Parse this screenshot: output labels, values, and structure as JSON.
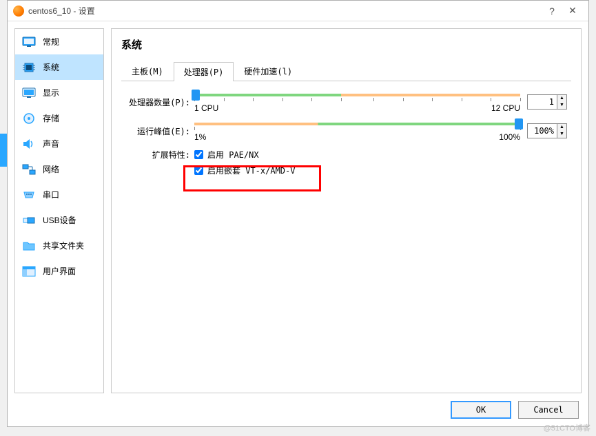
{
  "window": {
    "title": "centos6_10 - 设置"
  },
  "sidebar": {
    "items": [
      {
        "label": "常规"
      },
      {
        "label": "系统"
      },
      {
        "label": "显示"
      },
      {
        "label": "存储"
      },
      {
        "label": "声音"
      },
      {
        "label": "网络"
      },
      {
        "label": "串口"
      },
      {
        "label": "USB设备"
      },
      {
        "label": "共享文件夹"
      },
      {
        "label": "用户界面"
      }
    ]
  },
  "content": {
    "title": "系统",
    "tabs": [
      {
        "label": "主板(M)"
      },
      {
        "label": "处理器(P)"
      },
      {
        "label": "硬件加速(l)"
      }
    ],
    "cpu_count": {
      "label": "处理器数量(P):",
      "value": "1",
      "min_label": "1 CPU",
      "max_label": "12 CPU"
    },
    "exec_cap": {
      "label": "运行峰值(E):",
      "value": "100%",
      "min_label": "1%",
      "max_label": "100%"
    },
    "ext_features": {
      "label": "扩展特性:",
      "pae": "启用 PAE/NX",
      "nested": "启用嵌套 VT-x/AMD-V"
    }
  },
  "footer": {
    "ok": "OK",
    "cancel": "Cancel"
  },
  "watermark": "@51CTO博客"
}
